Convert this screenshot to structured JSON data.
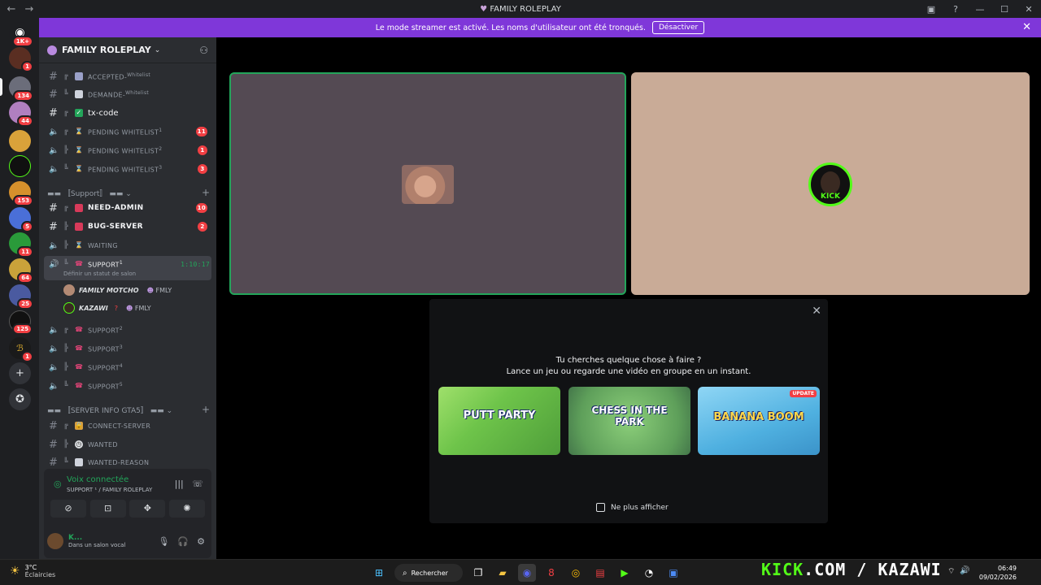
{
  "window": {
    "title": "FAMILY ROLEPLAY"
  },
  "banner": {
    "text": "Le mode streamer est activé. Les noms d'utilisateur ont été tronqués.",
    "button": "Désactiver"
  },
  "rail": {
    "badges": [
      "1K+",
      "1",
      "134",
      "44",
      "153",
      "5",
      "11",
      "64",
      "25",
      "125",
      "1"
    ]
  },
  "guild": {
    "name": "FAMILY ROLEPLAY"
  },
  "channels": [
    {
      "name": "ACCEPTED-",
      "sup": "Whitelist",
      "type": "text",
      "emoji": "✉"
    },
    {
      "name": "DEMANDE-",
      "sup": "Whitelist",
      "type": "text",
      "emoji": "▯"
    },
    {
      "name": "tx-code",
      "type": "text",
      "emoji": "✓",
      "bold": true
    },
    {
      "name": "PENDING WHITELIST",
      "sup": "1",
      "type": "voice",
      "emoji": "⌛",
      "count": "11"
    },
    {
      "name": "PENDING WHITELIST",
      "sup": "2",
      "type": "voice",
      "emoji": "⌛",
      "count": "1"
    },
    {
      "name": "PENDING WHITELIST",
      "sup": "3",
      "type": "voice",
      "emoji": "⌛",
      "count": "3"
    }
  ],
  "category_support": "〚Support〛",
  "support_channels": [
    {
      "name": "NEED-ADMIN",
      "type": "text",
      "emoji": "🆘",
      "count": "10",
      "bold": true
    },
    {
      "name": "BUG-SERVER",
      "type": "text",
      "emoji": "🆘",
      "count": "2",
      "bold": true
    },
    {
      "name": "WAITING",
      "type": "voice",
      "emoji": "⌛"
    }
  ],
  "active_voice": {
    "name": "SUPPORT",
    "sup": "1",
    "timer": "1:10:17",
    "status": "Définir un statut de salon",
    "users": [
      {
        "name": "FAMILY MOTCHO",
        "tag": "FMLY"
      },
      {
        "name": "KAZAWI",
        "tag": "FMLY"
      }
    ]
  },
  "support_voice": [
    {
      "name": "SUPPORT",
      "sup": "2"
    },
    {
      "name": "SUPPORT",
      "sup": "3"
    },
    {
      "name": "SUPPORT",
      "sup": "4"
    },
    {
      "name": "SUPPORT",
      "sup": "5"
    }
  ],
  "category_info": "〚SERVER INFO GTA5〛",
  "info_channels": [
    {
      "name": "CONNECT-SERVER",
      "emoji": "🔒"
    },
    {
      "name": "WANTED",
      "emoji": "◷"
    },
    {
      "name": "WANTED-REASON",
      "emoji": "▯"
    }
  ],
  "voice_panel": {
    "title": "Voix connectée",
    "subtitle": "SUPPORT ¹ / FAMILY ROLEPLAY"
  },
  "user": {
    "name": "K...",
    "status": "Dans un salon vocal"
  },
  "stage": {
    "popup_line1": "Tu cherches quelque chose à faire ?",
    "popup_line2": "Lance un jeu ou regarde une vidéo en groupe en un instant.",
    "activities": [
      {
        "label": "PUTT PARTY"
      },
      {
        "label": "CHESS IN THE PARK"
      },
      {
        "label": "BANANA BOOM",
        "badge": "UPDATE"
      }
    ],
    "dont_show": "Ne plus afficher"
  },
  "taskbar": {
    "temp": "3°C",
    "weather": "Éclaircies",
    "search": "Rechercher",
    "overlay_kick": "KICK",
    "overlay_rest": ".COM / KAZAWI",
    "time": "06:49",
    "date": "09/02/2026"
  },
  "colors": {
    "accent": "#5865f2",
    "banner": "#7f37d9",
    "green": "#23a55a",
    "kick": "#53fc18",
    "badge": "#f23f43"
  }
}
